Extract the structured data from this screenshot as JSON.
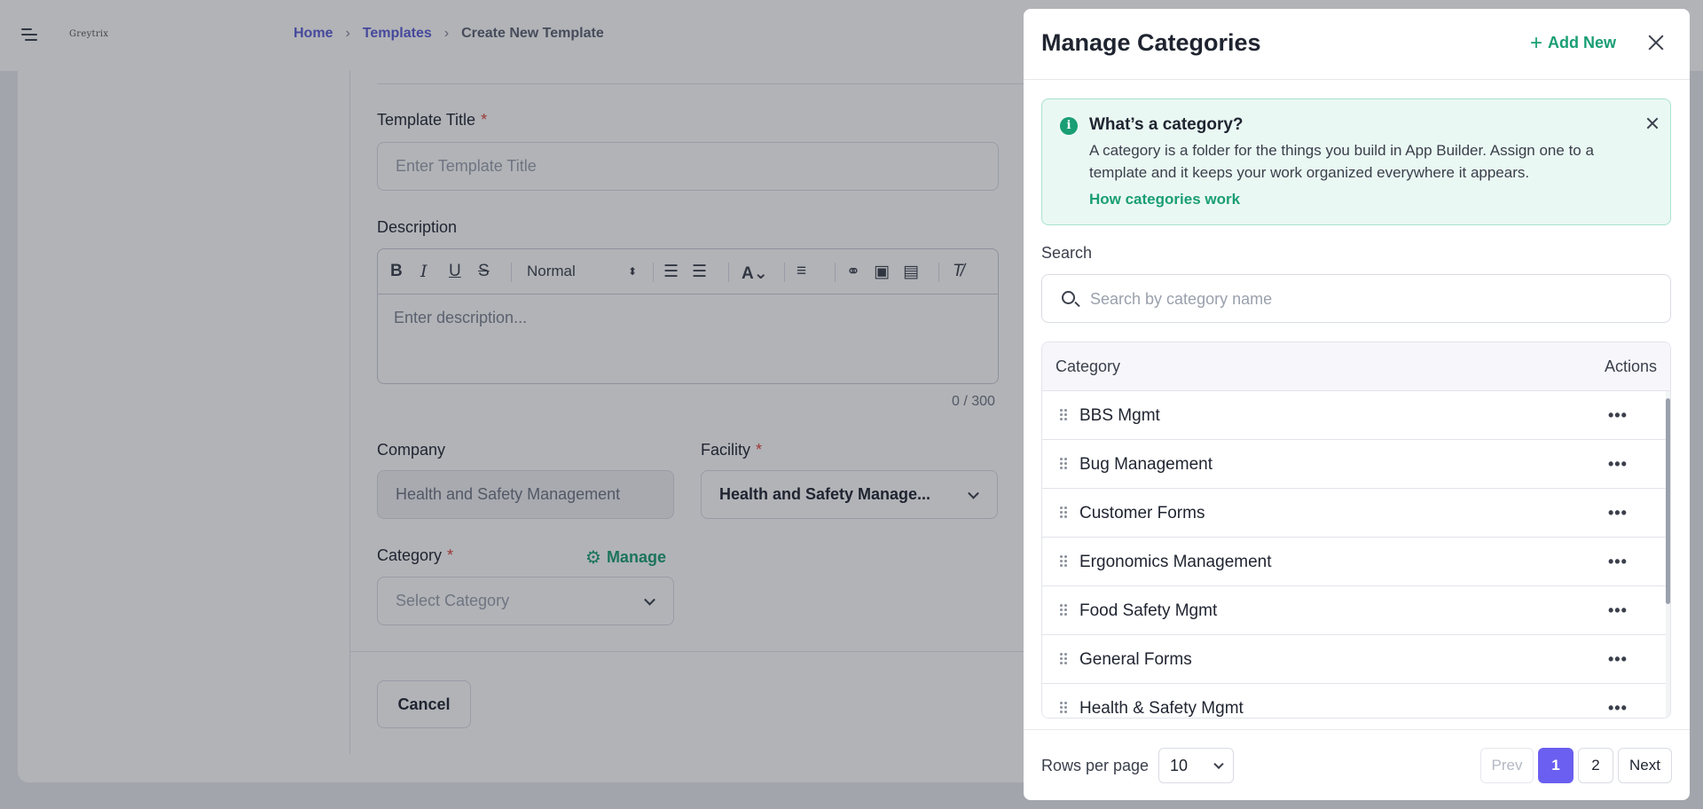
{
  "header": {
    "logo_text": "Greytrix",
    "breadcrumb": [
      "Home",
      "Templates",
      "Create New Template"
    ]
  },
  "form": {
    "template_title_label": "Template Title",
    "template_title_placeholder": "Enter Template Title",
    "description_label": "Description",
    "editor": {
      "heading_select": "Normal",
      "placeholder": "Enter description...",
      "counter": "0 / 300"
    },
    "company_label": "Company",
    "company_value": "Health and Safety Management",
    "facility_label": "Facility",
    "facility_value": "Health and Safety Manage...",
    "category_label": "Category",
    "category_placeholder": "Select Category",
    "manage_label": "Manage",
    "required_mark": "*",
    "cancel_label": "Cancel"
  },
  "modal": {
    "title": "Manage Categories",
    "add_new_label": "Add New",
    "info": {
      "title": "What’s a category?",
      "text": "A category is a folder for the things you build in App Builder. Assign one to a template and it keeps your work organized everywhere it appears.",
      "link": "How categories work"
    },
    "search": {
      "label": "Search",
      "placeholder": "Search by category name"
    },
    "table": {
      "columns": [
        "Category",
        "Actions"
      ],
      "rows": [
        "BBS Mgmt",
        "Bug Management",
        "Customer Forms",
        "Ergonomics Management",
        "Food Safety Mgmt",
        "General Forms",
        "Health & Safety Mgmt"
      ],
      "row_action_glyph": "•••"
    },
    "footer": {
      "rows_per_page_label": "Rows per page",
      "rows_per_page_value": "10",
      "prev_label": "Prev",
      "pages": [
        "1",
        "2"
      ],
      "current_page": "1",
      "next_label": "Next"
    }
  },
  "colors": {
    "accent_green": "#1a9e74",
    "accent_purple": "#6a5ff0",
    "breadcrumb_link": "#5b5bd6",
    "required_red": "#e0423c"
  },
  "icons": [
    "menu-toggle-icon",
    "chevron-right-icon",
    "bold-icon",
    "italic-icon",
    "underline-icon",
    "strikethrough-icon",
    "ordered-list-icon",
    "bullet-list-icon",
    "text-color-icon",
    "align-icon",
    "link-icon",
    "image-icon",
    "video-icon",
    "clear-format-icon",
    "gear-icon",
    "plus-icon",
    "close-icon",
    "info-icon",
    "search-icon",
    "drag-handle-icon",
    "more-horizontal-icon",
    "chevron-down-icon"
  ]
}
